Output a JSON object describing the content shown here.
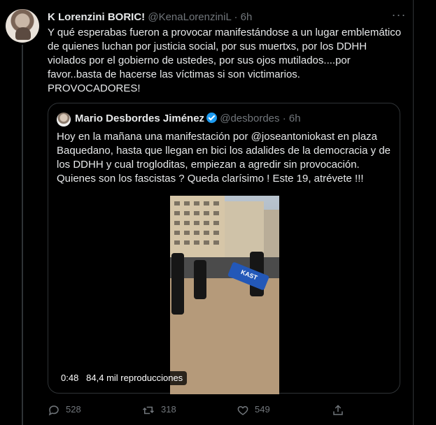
{
  "tweet": {
    "author_name": "K Lorenzini BORIC!",
    "handle": "@KenaLorenziniL",
    "separator": "·",
    "time": "6h",
    "text_lines": [
      "Y qué esperabas fueron a provocar manifestándose a un lugar emblemático",
      "de quienes luchan por justicia social, por sus muertxs, por los DDHH",
      "violados por el gobierno de ustedes, por sus ojos mutilados....por",
      "favor..basta de hacerse las víctimas si son victimarios.",
      "PROVOCADORES!"
    ]
  },
  "quoted": {
    "author_name": "Mario Desbordes Jiménez",
    "handle": "@desbordes",
    "separator": "·",
    "time": "6h",
    "text_lines": [
      "Hoy en la mañana una manifestación por @joseantoniokast en plaza",
      "Baquedano, hasta que llegan en bici los adalides de la democracia y de",
      "los DDHH y cual trogloditas, empiezan a agredir sin provocación.",
      "Quienes son los fascistas ? Queda clarísimo ! Este 19, atrévete !!!"
    ],
    "video": {
      "duration": "0:48",
      "views": "84,4 mil reproducciones",
      "flag_text": "KAST"
    }
  },
  "actions": {
    "reply_count": "528",
    "retweet_count": "318",
    "like_count": "549"
  },
  "colors": {
    "background": "#000000",
    "muted": "#71767b",
    "border": "#2f3336",
    "verified": "#1d9bf0"
  }
}
